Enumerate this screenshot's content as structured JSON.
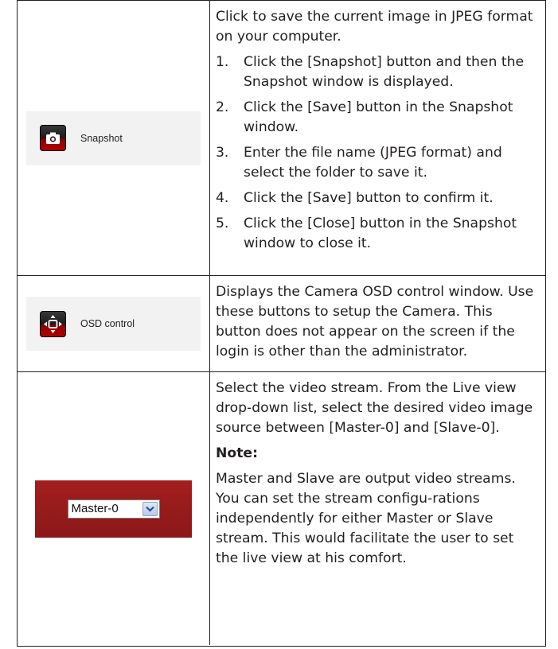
{
  "rows": [
    {
      "button": {
        "label": "Snapshot",
        "icon": "camera-icon"
      },
      "intro": "Click to save the current image in JPEG format on your computer.",
      "steps": [
        {
          "num": "1.",
          "text": "Click the [Snapshot] button and then the Snapshot window is displayed."
        },
        {
          "num": "2.",
          "text": "Click the [Save] button in the Snapshot window."
        },
        {
          "num": "3.",
          "text": "Enter the file name (JPEG format) and select the folder to save it."
        },
        {
          "num": "4.",
          "text": "Click the [Save] button to confirm it."
        },
        {
          "num": "5.",
          "text": "Click the [Close] button in the Snapshot window to close it."
        }
      ]
    },
    {
      "button": {
        "label": "OSD control",
        "icon": "directional-pad-icon"
      },
      "description": "Displays the Camera OSD control window. Use these buttons to setup the Camera. This button does not appear on the screen if the login is other than the administrator."
    },
    {
      "select": {
        "value": "Master-0",
        "icon": "chevron-down-icon"
      },
      "description": "Select the video stream. From the Live view drop-down list, select the desired video image source between [Master-0] and [Slave-0].",
      "note_heading": "Note:",
      "note_text": "Master and Slave are output video streams. You can set the stream configu-rations independently for either Master or Slave stream. This would facilitate the user to set the live view at his comfort."
    }
  ],
  "colors": {
    "icon_red": "#b30000",
    "panel_red": "#9a1c1c",
    "border": "#231f20"
  }
}
